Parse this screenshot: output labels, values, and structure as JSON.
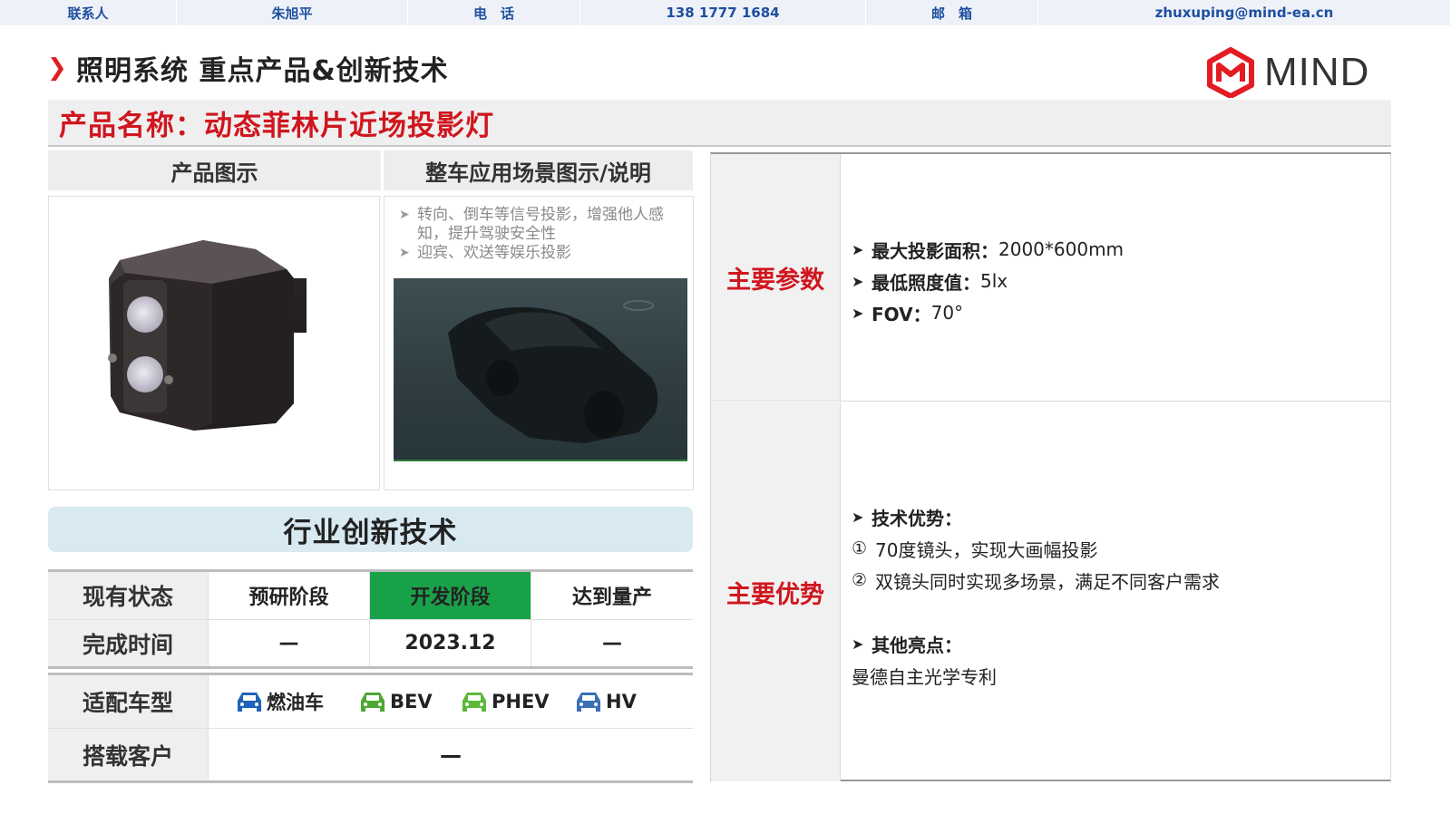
{
  "contact": {
    "contact_label": "联系人",
    "contact_name": "朱旭平",
    "phone_label": "电　话",
    "phone": "138 1777 1684",
    "email_label": "邮　箱",
    "email": "zhuxuping@mind-ea.cn"
  },
  "header": {
    "title": "照明系统 重点产品&创新技术",
    "logo_text": "MIND",
    "accent_color": "#e31b23"
  },
  "product": {
    "name": "产品名称：动态菲林片近场投影灯"
  },
  "left": {
    "product_image_header": "产品图示",
    "scene_header": "整车应用场景图示/说明",
    "scene_bullets": [
      "转向、倒车等信号投影，增强他人感知，提升驾驶安全性",
      "迎宾、欢送等娱乐投影"
    ]
  },
  "innovation": {
    "title": "行业创新技术"
  },
  "status": {
    "row1_label": "现有状态",
    "stages": [
      "预研阶段",
      "开发阶段",
      "达到量产"
    ],
    "active_stage": "开发阶段",
    "row2_label": "完成时间",
    "times": [
      "—",
      "2023.12",
      "—"
    ]
  },
  "vehicles": {
    "label": "适配车型",
    "types": [
      {
        "name": "燃油车",
        "color": "#1f63b8"
      },
      {
        "name": "BEV",
        "color": "#4ea733"
      },
      {
        "name": "PHEV",
        "color": "#5cb83a"
      },
      {
        "name": "HV",
        "color": "#3a6fb8"
      }
    ],
    "customer_label": "搭载客户",
    "customer_value": "—"
  },
  "params": {
    "label": "主要参数",
    "items": [
      {
        "key": "最大投影面积：",
        "value": "2000*600mm"
      },
      {
        "key": "最低照度值：",
        "value": "5lx"
      },
      {
        "key": "FOV：",
        "value": "70°"
      }
    ]
  },
  "advantages": {
    "label": "主要优势",
    "tech_title": "技术优势：",
    "tech_items": [
      {
        "mark": "①",
        "text": "70度镜头，实现大画幅投影"
      },
      {
        "mark": "②",
        "text": "双镜头同时实现多场景，满足不同客户需求"
      }
    ],
    "other_title": "其他亮点：",
    "other_text": "曼德自主光学专利"
  }
}
